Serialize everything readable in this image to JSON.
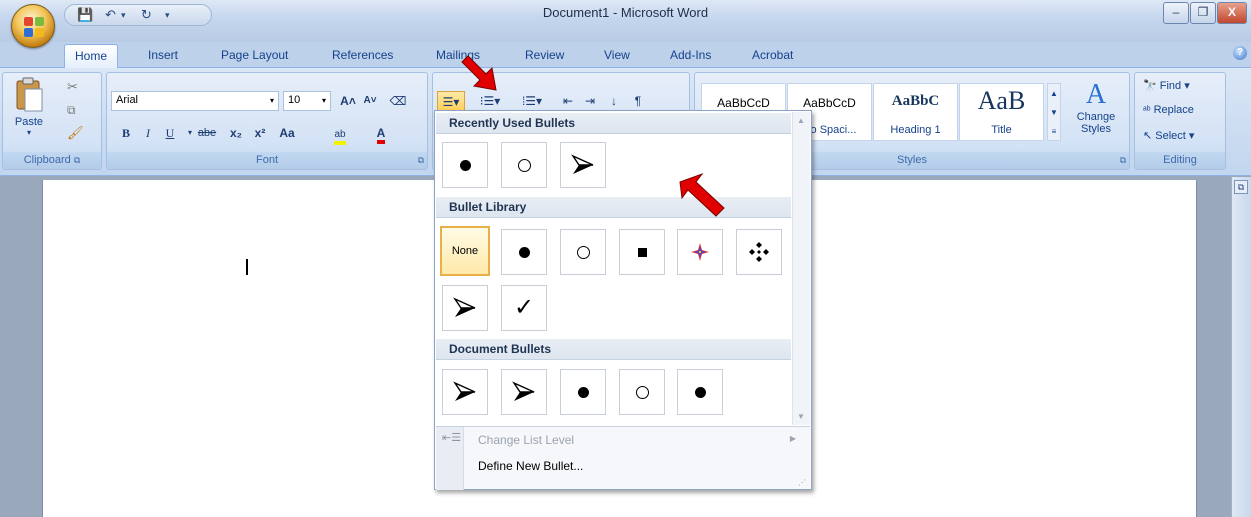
{
  "window": {
    "title": "Document1 - Microsoft Word",
    "controls": [
      "–",
      "❐",
      "X"
    ]
  },
  "tabs": [
    "Home",
    "Insert",
    "Page Layout",
    "References",
    "Mailings",
    "Review",
    "View",
    "Add-Ins",
    "Acrobat"
  ],
  "active_tab": "Home",
  "clipboard": {
    "paste": "Paste",
    "label": "Clipboard"
  },
  "font": {
    "name": "Arial",
    "size": "10",
    "bold": "B",
    "italic": "I",
    "underline": "U",
    "strike": "abe",
    "sub": "x₂",
    "sup": "x²",
    "case": "Aa",
    "label": "Font"
  },
  "styles": {
    "items": [
      {
        "sample": "AaBbCcD",
        "name": ""
      },
      {
        "sample": "AaBbCcD",
        "name": "No Spaci..."
      },
      {
        "sample": "AaBbC",
        "name": "Heading 1"
      },
      {
        "sample": "AaB",
        "name": "Title"
      }
    ],
    "change_styles": "Change Styles",
    "label": "Styles"
  },
  "editing": {
    "find": "Find",
    "replace": "Replace",
    "select": "Select",
    "label": "Editing"
  },
  "bullets_dropdown": {
    "recent_header": "Recently Used Bullets",
    "recent": [
      "dot",
      "ring",
      "arrow"
    ],
    "library_header": "Bullet Library",
    "library": [
      "None",
      "dot",
      "ring",
      "square",
      "star",
      "diamonds",
      "arrow",
      "check"
    ],
    "document_header": "Document Bullets",
    "document": [
      "arrow",
      "arrow",
      "dot",
      "ring",
      "dot"
    ],
    "change_level": "Change List Level",
    "define_new": "Define New Bullet..."
  },
  "colors": {
    "accent": "#15428b",
    "ribbon": "#c9daf0",
    "highlight": "#ffe9a8",
    "annotation_arrow": "#e00000"
  }
}
